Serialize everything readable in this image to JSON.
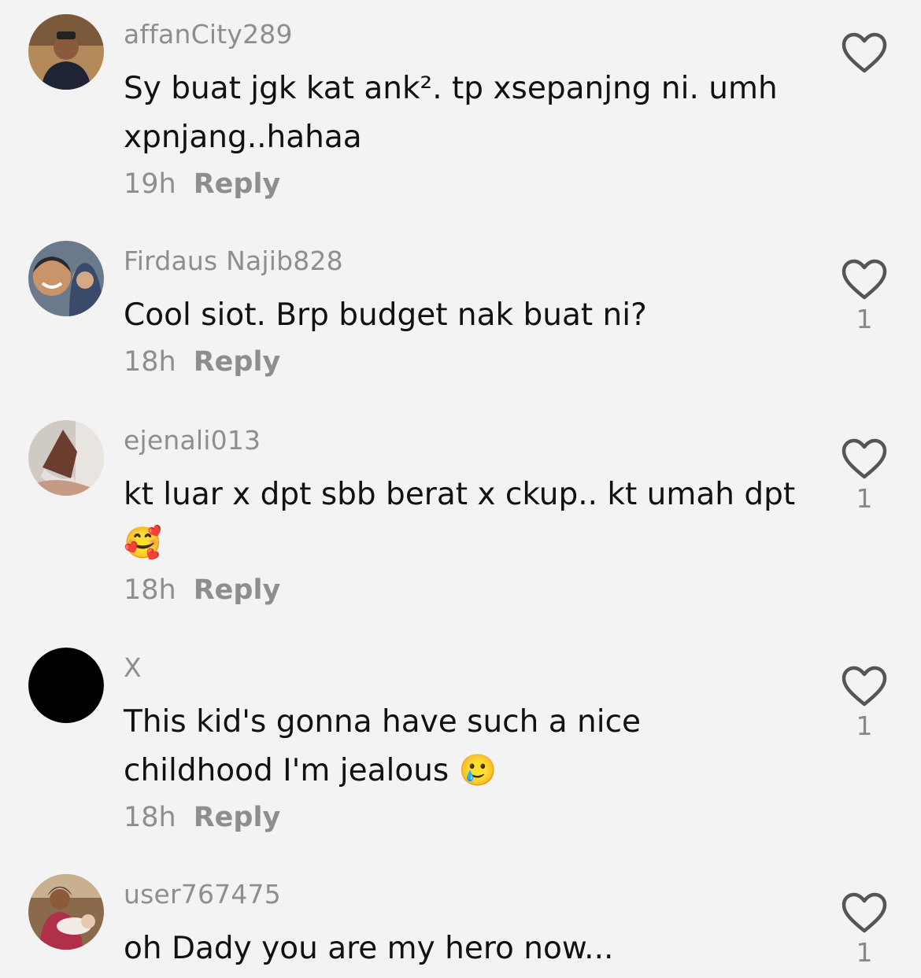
{
  "comments": [
    {
      "username": "affanCity289",
      "text": "Sy buat jgk kat ank². tp xsepanjng ni. umh xpnjang..hahaa",
      "time": "19h",
      "reply_label": "Reply",
      "likes": "",
      "avatar_icon": "user-photo"
    },
    {
      "username": "Firdaus Najib828",
      "text": "Cool siot. Brp budget nak buat ni?",
      "time": "18h",
      "reply_label": "Reply",
      "likes": "1",
      "avatar_icon": "user-photo"
    },
    {
      "username": "ejenali013",
      "text": "kt luar x dpt sbb berat x ckup.. kt umah dpt 🥰",
      "time": "18h",
      "reply_label": "Reply",
      "likes": "1",
      "avatar_icon": "user-photo"
    },
    {
      "username": "X",
      "text": "This kid's gonna have such a nice childhood I'm jealous 🥲",
      "time": "18h",
      "reply_label": "Reply",
      "likes": "1",
      "avatar_icon": "black-circle"
    },
    {
      "username": "user767475",
      "text": "oh Dady you are my hero now...",
      "time": "",
      "reply_label": "",
      "likes": "1",
      "avatar_icon": "user-photo"
    }
  ],
  "icons": {
    "like": "heart-outline-icon"
  },
  "colors": {
    "background": "#f3f3f3",
    "username": "#8e8e8e",
    "text": "#111111",
    "icon": "#555555"
  }
}
